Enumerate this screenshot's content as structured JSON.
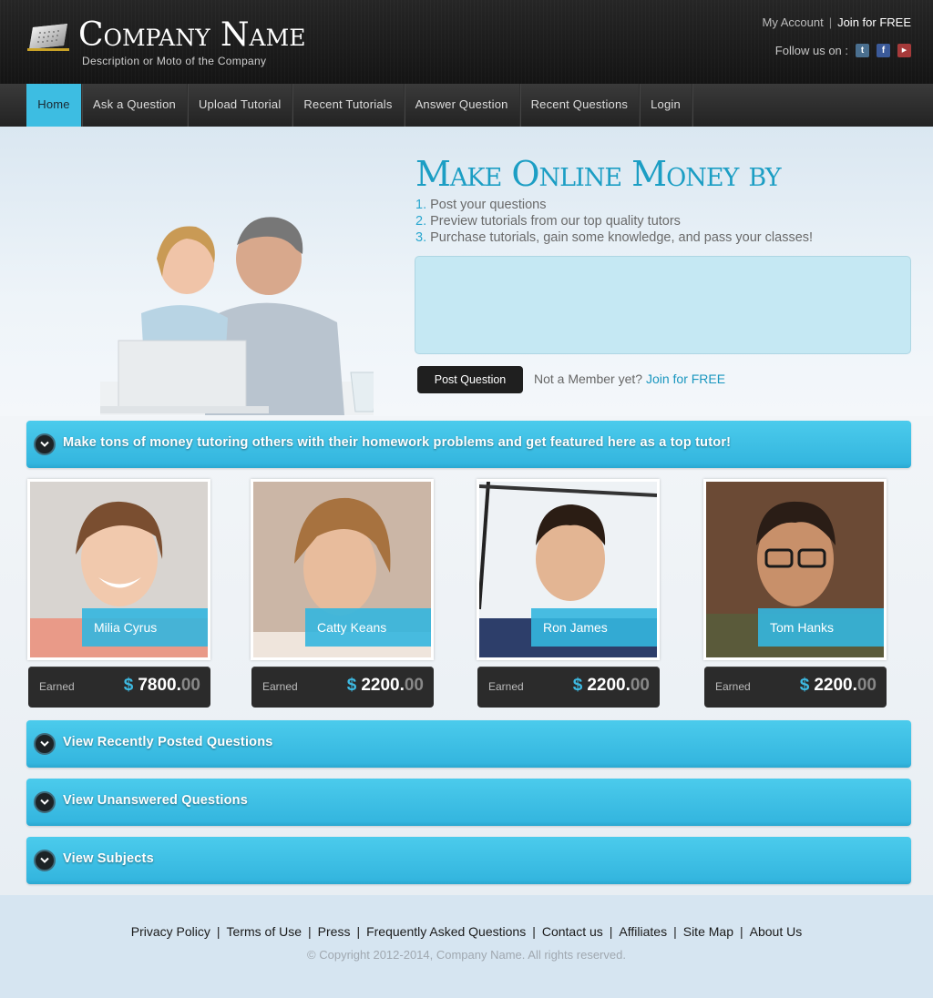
{
  "header": {
    "company_name": "Company Name",
    "moto": "Description or Moto of the Company",
    "my_account": "My Account",
    "separator": "|",
    "join": "Join for FREE",
    "follow_label": "Follow us on :",
    "social": [
      "twitter-icon",
      "facebook-icon",
      "youtube-icon"
    ]
  },
  "nav": {
    "items": [
      "Home",
      "Ask a Question",
      "Upload Tutorial",
      "Recent Tutorials",
      "Answer Question",
      "Recent Questions",
      "Login"
    ],
    "active": "Home"
  },
  "hero": {
    "title": "Make Online Money by",
    "steps": [
      {
        "num": "1.",
        "text": "Post your questions"
      },
      {
        "num": "2.",
        "text": "Preview tutorials from our top quality tutors"
      },
      {
        "num": "3.",
        "text": "Purchase tutorials, gain some knowledge, and pass your classes!"
      }
    ],
    "question_value": "",
    "post_button": "Post Question",
    "member_text": "Not a Member yet?",
    "member_link": "Join for FREE"
  },
  "banner": {
    "text": "Make tons of money tutoring others with their homework problems and get featured here as a top tutor!"
  },
  "tutors": [
    {
      "name": "Milia Cyrus",
      "earned_label": "Earned",
      "currency": "$",
      "amount": "7800.",
      "cents": "00"
    },
    {
      "name": "Catty Keans",
      "earned_label": "Earned",
      "currency": "$",
      "amount": "2200.",
      "cents": "00"
    },
    {
      "name": "Ron James",
      "earned_label": "Earned",
      "currency": "$",
      "amount": "2200.",
      "cents": "00"
    },
    {
      "name": "Tom Hanks",
      "earned_label": "Earned",
      "currency": "$",
      "amount": "2200.",
      "cents": "00"
    }
  ],
  "sections": [
    {
      "label": "View Recently Posted Questions"
    },
    {
      "label": "View Unanswered Questions"
    },
    {
      "label": "View Subjects"
    }
  ],
  "footer": {
    "links": [
      "Privacy Policy",
      "Terms of Use",
      "Press",
      "Frequently Asked Questions",
      "Contact us",
      "Affiliates",
      "Site Map",
      "About Us"
    ],
    "separator": "|",
    "copyright": "© Copyright 2012-2014, Company Name. All rights reserved."
  },
  "colors": {
    "accent": "#3dbde2",
    "dark": "#1f1f1f",
    "link": "#1996bf"
  }
}
